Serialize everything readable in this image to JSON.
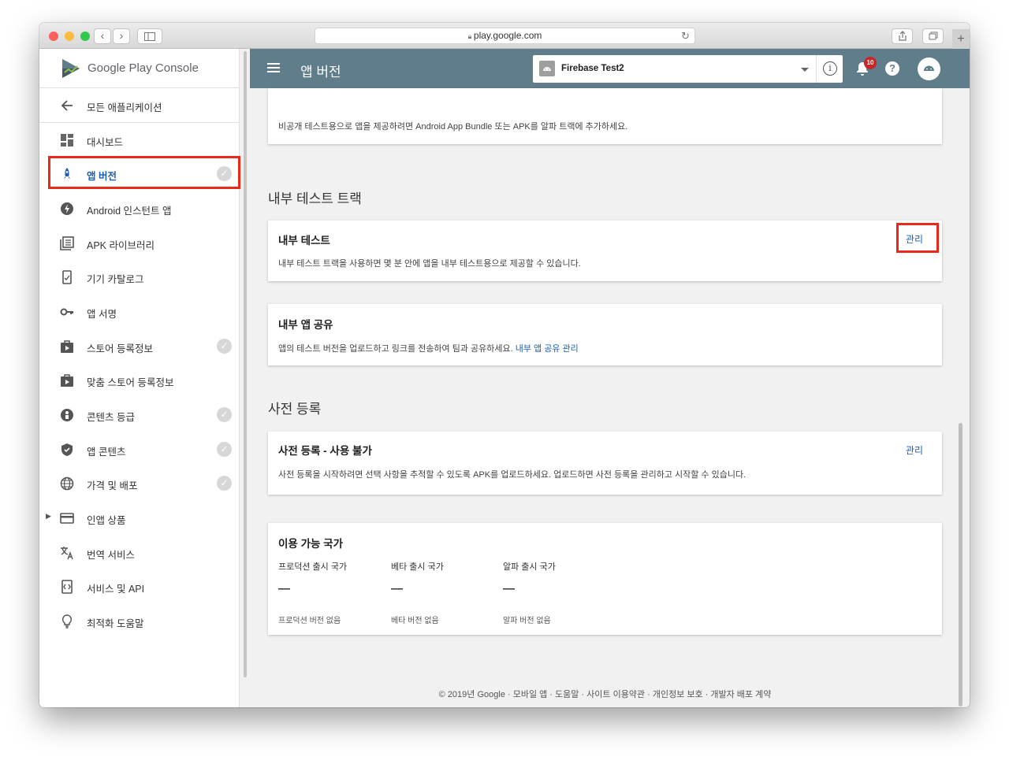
{
  "browser": {
    "url": "play.google.com",
    "new_tab": "+"
  },
  "sidebar": {
    "logo_google_play": "Google Play",
    "logo_console": "Console",
    "items": [
      {
        "label": "모든 애플리케이션",
        "icon": "arrow-back-icon"
      },
      {
        "label": "대시보드",
        "icon": "dashboard-icon"
      },
      {
        "label": "앱 버전",
        "icon": "rocket-icon"
      },
      {
        "label": "Android 인스턴트 앱",
        "icon": "flash-icon"
      },
      {
        "label": "APK 라이브러리",
        "icon": "library-icon"
      },
      {
        "label": "기기 카탈로그",
        "icon": "device-icon"
      },
      {
        "label": "앱 서명",
        "icon": "key-icon"
      },
      {
        "label": "스토어 등록정보",
        "icon": "store-icon"
      },
      {
        "label": "맞춤 스토어 등록정보",
        "icon": "store-custom-icon"
      },
      {
        "label": "콘텐츠 등급",
        "icon": "rating-icon"
      },
      {
        "label": "앱 콘텐츠",
        "icon": "shield-icon"
      },
      {
        "label": "가격 및 배포",
        "icon": "globe-icon"
      },
      {
        "label": "인앱 상품",
        "icon": "card-icon"
      },
      {
        "label": "번역 서비스",
        "icon": "translate-icon"
      },
      {
        "label": "서비스 및 API",
        "icon": "api-icon"
      },
      {
        "label": "최적화 도움말",
        "icon": "lightbulb-icon"
      }
    ]
  },
  "header": {
    "title": "앱 버전",
    "app_name": "Firebase Test2",
    "notification_count": "10"
  },
  "main": {
    "top_card_text": "비공개 테스트용으로 앱을 제공하려면 Android App Bundle 또는 APK를 알파 트랙에 추가하세요.",
    "internal_section": "내부 테스트 트랙",
    "internal_test": {
      "title": "내부 테스트",
      "desc": "내부 테스트 트랙을 사용하면 몇 분 안에 앱을 내부 테스트용으로 제공할 수 있습니다.",
      "manage": "관리"
    },
    "internal_share": {
      "title": "내부 앱 공유",
      "desc": "앱의 테스트 버전을 업로드하고 링크를 전송하여 팀과 공유하세요.",
      "link": "내부 앱 공유 관리"
    },
    "prereg_section": "사전 등록",
    "prereg": {
      "title": "사전 등록 - 사용 불가",
      "desc": "사전 등록을 시작하려면 선택 사항을 추적할 수 있도록 APK를 업로드하세요. 업로드하면 사전 등록을 관리하고 시작할 수 있습니다.",
      "manage": "관리"
    },
    "countries": {
      "title": "이용 가능 국가",
      "columns": [
        {
          "header": "프로덕션 출시 국가",
          "value": "—",
          "footer": "프로덕션 버전 없음"
        },
        {
          "header": "베타 출시 국가",
          "value": "—",
          "footer": "베타 버전 없음"
        },
        {
          "header": "알파 출시 국가",
          "value": "—",
          "footer": "알파 버전 없음"
        }
      ]
    },
    "footer": "© 2019년 Google · 모바일 앱 · 도움말 · 사이트 이용약관 · 개인정보 보호 · 개발자 배포 계약"
  },
  "colors": {
    "header": "#607d8b",
    "link": "#1a5fb4",
    "active": "#1a5fb4",
    "highlight": "#e8291c"
  }
}
